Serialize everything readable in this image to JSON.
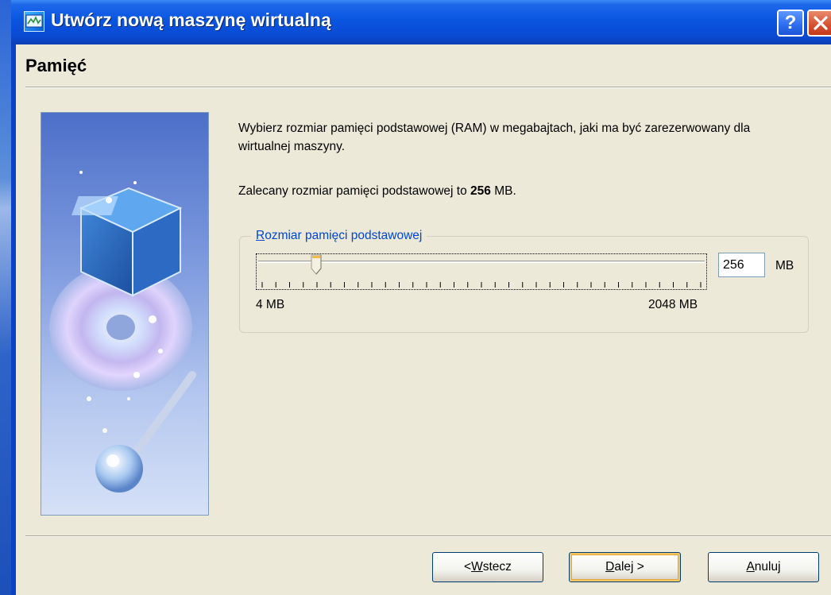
{
  "window": {
    "title": "Utwórz nową maszynę wirtualną",
    "help_label": "?",
    "close_label": "✕"
  },
  "page": {
    "title": "Pamięć"
  },
  "content": {
    "description": "Wybierz rozmiar pamięci podstawowej (RAM) w megabajtach, jaki ma być zarezerwowany dla wirtualnej maszyny.",
    "recommended_prefix": "Zalecany rozmiar pamięci podstawowej to ",
    "recommended_value": "256",
    "recommended_suffix": " MB."
  },
  "memory_group": {
    "legend_accel": "R",
    "legend_rest": "ozmiar pamięci podstawowej",
    "min_label": "4 MB",
    "max_label": "2048 MB",
    "slider_min": 4,
    "slider_max": 2048,
    "slider_value": 256,
    "tick_count": 33,
    "input_value": "256",
    "unit_label": "MB"
  },
  "buttons": {
    "back_prefix": "< ",
    "back_accel": "W",
    "back_rest": "stecz",
    "next_accel": "D",
    "next_rest": "alej >",
    "cancel_accel": "A",
    "cancel_rest": "nuluj"
  },
  "colors": {
    "titlebar": "#0a55df",
    "dialog_bg": "#ece9d8",
    "legend_text": "#0046d5"
  }
}
